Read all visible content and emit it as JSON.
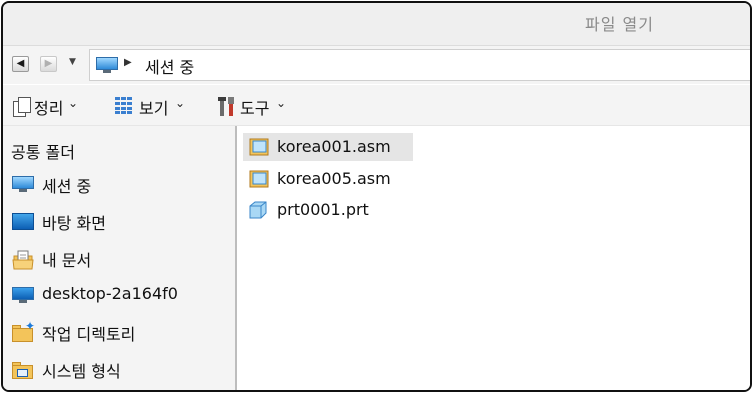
{
  "window": {
    "title": "파일 열기"
  },
  "address": {
    "crumb": "세션 중"
  },
  "toolbar": {
    "organize_label": "정리",
    "view_label": "보기",
    "tools_label": "도구"
  },
  "sidebar": {
    "heading": "공통 폴더",
    "items": [
      {
        "label": "세션 중",
        "icon": "monitor-icon"
      },
      {
        "label": "바탕 화면",
        "icon": "desktop-icon"
      },
      {
        "label": "내 문서",
        "icon": "documents-icon"
      },
      {
        "label": "desktop-2a164f0",
        "icon": "computer-icon"
      },
      {
        "label": "작업 디렉토리",
        "icon": "working-folder-icon"
      },
      {
        "label": "시스템 형식",
        "icon": "system-format-folder-icon"
      }
    ]
  },
  "files": [
    {
      "name": "korea001.asm",
      "icon": "assembly-icon",
      "selected": true
    },
    {
      "name": "korea005.asm",
      "icon": "assembly-icon",
      "selected": false
    },
    {
      "name": "prt0001.prt",
      "icon": "part-icon",
      "selected": false
    }
  ],
  "colors": {
    "accent": "#2f8ad8",
    "selection": "#e5e5e5",
    "chrome": "#f4f4f4"
  }
}
